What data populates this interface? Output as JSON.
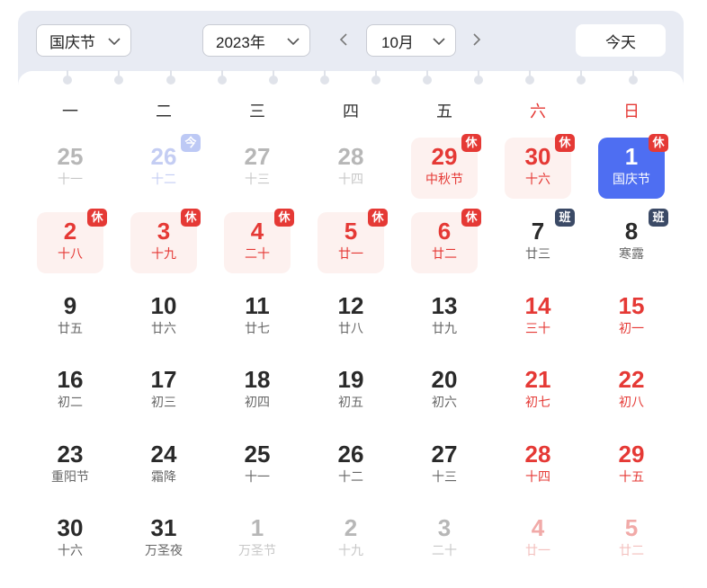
{
  "toolbar": {
    "holiday_select": "国庆节",
    "year_select": "2023年",
    "month_select": "10月",
    "today_label": "今天"
  },
  "weekdays": [
    "一",
    "二",
    "三",
    "四",
    "五",
    "六",
    "日"
  ],
  "badges": {
    "rest": "休",
    "work": "班",
    "today": "今"
  },
  "colors": {
    "accent": "#4e6ef2",
    "holiday_red": "#e53935",
    "work_badge": "#3b4a66",
    "panel": "#e8ebf3"
  },
  "weeks": [
    [
      {
        "day": "25",
        "lunar": "十一",
        "kind": "other"
      },
      {
        "day": "26",
        "lunar": "十二",
        "kind": "todaycell",
        "badge": "today"
      },
      {
        "day": "27",
        "lunar": "十三",
        "kind": "other"
      },
      {
        "day": "28",
        "lunar": "十四",
        "kind": "other"
      },
      {
        "day": "29",
        "lunar": "中秋节",
        "kind": "hol",
        "badge": "rest"
      },
      {
        "day": "30",
        "lunar": "十六",
        "kind": "hol",
        "badge": "rest"
      },
      {
        "day": "1",
        "lunar": "国庆节",
        "kind": "sel",
        "badge": "rest"
      }
    ],
    [
      {
        "day": "2",
        "lunar": "十八",
        "kind": "hol",
        "badge": "rest"
      },
      {
        "day": "3",
        "lunar": "十九",
        "kind": "hol",
        "badge": "rest"
      },
      {
        "day": "4",
        "lunar": "二十",
        "kind": "hol",
        "badge": "rest"
      },
      {
        "day": "5",
        "lunar": "廿一",
        "kind": "hol",
        "badge": "rest"
      },
      {
        "day": "6",
        "lunar": "廿二",
        "kind": "hol",
        "badge": "rest"
      },
      {
        "day": "7",
        "lunar": "廿三",
        "kind": "normal",
        "badge": "work"
      },
      {
        "day": "8",
        "lunar": "寒露",
        "kind": "normal",
        "badge": "work"
      }
    ],
    [
      {
        "day": "9",
        "lunar": "廿五",
        "kind": "normal"
      },
      {
        "day": "10",
        "lunar": "廿六",
        "kind": "normal"
      },
      {
        "day": "11",
        "lunar": "廿七",
        "kind": "normal"
      },
      {
        "day": "12",
        "lunar": "廿八",
        "kind": "normal"
      },
      {
        "day": "13",
        "lunar": "廿九",
        "kind": "normal"
      },
      {
        "day": "14",
        "lunar": "三十",
        "kind": "red"
      },
      {
        "day": "15",
        "lunar": "初一",
        "kind": "red"
      }
    ],
    [
      {
        "day": "16",
        "lunar": "初二",
        "kind": "normal"
      },
      {
        "day": "17",
        "lunar": "初三",
        "kind": "normal"
      },
      {
        "day": "18",
        "lunar": "初四",
        "kind": "normal"
      },
      {
        "day": "19",
        "lunar": "初五",
        "kind": "normal"
      },
      {
        "day": "20",
        "lunar": "初六",
        "kind": "normal"
      },
      {
        "day": "21",
        "lunar": "初七",
        "kind": "red"
      },
      {
        "day": "22",
        "lunar": "初八",
        "kind": "red"
      }
    ],
    [
      {
        "day": "23",
        "lunar": "重阳节",
        "kind": "normal"
      },
      {
        "day": "24",
        "lunar": "霜降",
        "kind": "normal"
      },
      {
        "day": "25",
        "lunar": "十一",
        "kind": "normal"
      },
      {
        "day": "26",
        "lunar": "十二",
        "kind": "normal"
      },
      {
        "day": "27",
        "lunar": "十三",
        "kind": "normal"
      },
      {
        "day": "28",
        "lunar": "十四",
        "kind": "red"
      },
      {
        "day": "29",
        "lunar": "十五",
        "kind": "red"
      }
    ],
    [
      {
        "day": "30",
        "lunar": "十六",
        "kind": "normal"
      },
      {
        "day": "31",
        "lunar": "万圣夜",
        "kind": "normal"
      },
      {
        "day": "1",
        "lunar": "万圣节",
        "kind": "other"
      },
      {
        "day": "2",
        "lunar": "十九",
        "kind": "other"
      },
      {
        "day": "3",
        "lunar": "二十",
        "kind": "other"
      },
      {
        "day": "4",
        "lunar": "廿一",
        "kind": "otherred"
      },
      {
        "day": "5",
        "lunar": "廿二",
        "kind": "otherred"
      }
    ]
  ]
}
